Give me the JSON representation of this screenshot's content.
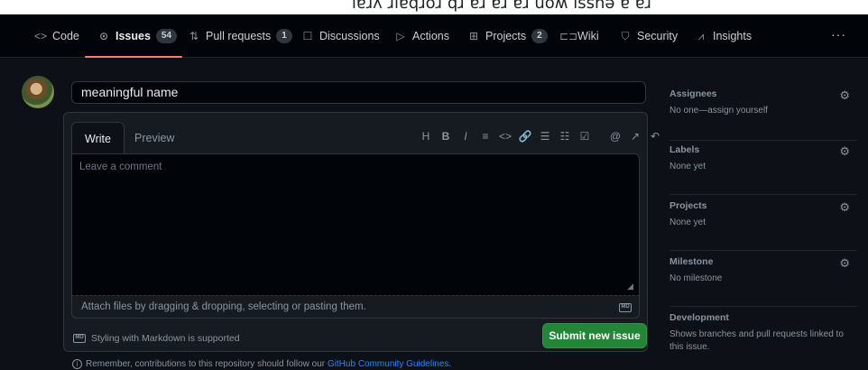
{
  "top_strip": {
    "text": "ıɐɹʎ ɹıɐqɹoɹ qɹ ɐɹ ɐɹ ɐɹ uoʍ ıssnǝ ɐ ɐɹ"
  },
  "nav": {
    "tabs": [
      {
        "icon": "code-icon",
        "glyph": "<>",
        "label": "Code",
        "count": null
      },
      {
        "icon": "issue-icon",
        "glyph": "⊙",
        "label": "Issues",
        "count": "54"
      },
      {
        "icon": "pull-request-icon",
        "glyph": "⇅",
        "label": "Pull requests",
        "count": "1"
      },
      {
        "icon": "discussions-icon",
        "glyph": "☐",
        "label": "Discussions",
        "count": null
      },
      {
        "icon": "actions-icon",
        "glyph": "▷",
        "label": "Actions",
        "count": null
      },
      {
        "icon": "projects-icon",
        "glyph": "⊞",
        "label": "Projects",
        "count": "2"
      },
      {
        "icon": "wiki-icon",
        "glyph": "⊏⊐",
        "label": "Wiki",
        "count": null
      },
      {
        "icon": "security-icon",
        "glyph": "⛉",
        "label": "Security",
        "count": null
      },
      {
        "icon": "insights-icon",
        "glyph": "⩘",
        "label": "Insights",
        "count": null
      }
    ],
    "more": "···"
  },
  "issue": {
    "title_value": "meaningful name",
    "write_tab": "Write",
    "preview_tab": "Preview",
    "toolbar": [
      "H",
      "B",
      "I",
      "≡",
      "<>",
      "🔗",
      "☰",
      "☷",
      "☑",
      "@",
      "↗",
      "↶"
    ],
    "comment_placeholder": "Leave a comment",
    "attach_text": "Attach files by dragging & dropping, selecting or pasting them.",
    "markdown_badge": "MD",
    "styling_text": "Styling with Markdown is supported",
    "submit_label": "Submit new issue",
    "remember_prefix": "Remember, contributions to this repository should follow our",
    "remember_link": "GitHub Community Guidelines",
    "remember_suffix": "."
  },
  "sidebar": {
    "assignees": {
      "title": "Assignees",
      "value": "No one—assign yourself"
    },
    "labels": {
      "title": "Labels",
      "value": "None yet"
    },
    "projects": {
      "title": "Projects",
      "value": "None yet"
    },
    "milestone": {
      "title": "Milestone",
      "value": "No milestone"
    },
    "development": {
      "title": "Development",
      "value": "Shows branches and pull requests linked to this issue."
    }
  },
  "colors": {
    "accent_underline": "#f78166",
    "submit_green": "#238636",
    "link_blue": "#2f81f7",
    "background": "#0d1117"
  }
}
